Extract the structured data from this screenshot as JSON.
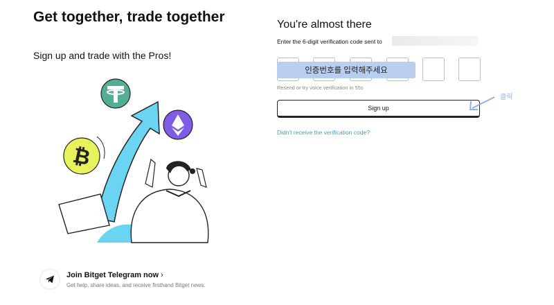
{
  "hero": {
    "title": "Get together, trade together",
    "subtitle": "Sign up and trade with the Pros!"
  },
  "illustration": {
    "coins": [
      "tether-icon",
      "ethereum-icon",
      "bitcoin-icon"
    ]
  },
  "telegram": {
    "title": "Join Bitget Telegram now",
    "chevron": "›",
    "subtitle": "Get help, share ideas, and receive firsthand Bitget news."
  },
  "form": {
    "title": "You're almost there",
    "description": "Enter the 6-digit verification code sent to",
    "code_digits": [
      "",
      "",
      "",
      "",
      "",
      ""
    ],
    "overlay_text": "인증번호를 입력해주세요",
    "resend_text": "Resend or try voice verification in 55s",
    "signup_label": "Sign up",
    "no_code_link": "Didn't receive the verification code?"
  },
  "annotation": {
    "click_label": "클릭"
  },
  "colors": {
    "overlay": "#b9cdef",
    "link": "#4a9bbf",
    "arrow": "#6ad4f2",
    "hint": "#8fb0e6"
  }
}
